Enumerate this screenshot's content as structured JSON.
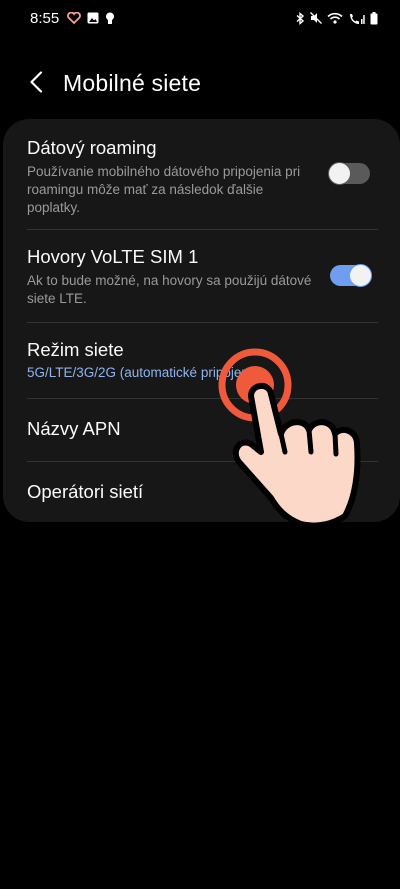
{
  "status_bar": {
    "time": "8:55",
    "icons": [
      "heart-icon",
      "image-icon",
      "bulb-icon",
      "bluetooth-icon",
      "mute-icon",
      "wifi-icon",
      "call-signal-icon",
      "battery-icon"
    ]
  },
  "header": {
    "title": "Mobilné siete",
    "back_icon": "chevron-left-icon"
  },
  "settings": {
    "data_roaming": {
      "title": "Dátový roaming",
      "description": "Používanie mobilného dátového pripojenia pri roamingu môže mať za následok ďalšie poplatky.",
      "enabled": false
    },
    "volte": {
      "title": "Hovory VoLTE SIM 1",
      "description": "Ak to bude možné, na hovory sa použijú dátové siete LTE.",
      "enabled": true
    },
    "network_mode": {
      "title": "Režim siete",
      "value": "5G/LTE/3G/2G (automatické pripojenie)"
    },
    "apn": {
      "title": "Názvy APN"
    },
    "operators": {
      "title": "Operátori sietí"
    }
  },
  "colors": {
    "background": "#000000",
    "card": "#171717",
    "accent": "#8fb4ee",
    "toggle_on": "#6f9ef0",
    "toggle_off": "#5a5a5a",
    "tap_ring": "#f05a3c",
    "hand_fill": "#fcd8c8"
  }
}
